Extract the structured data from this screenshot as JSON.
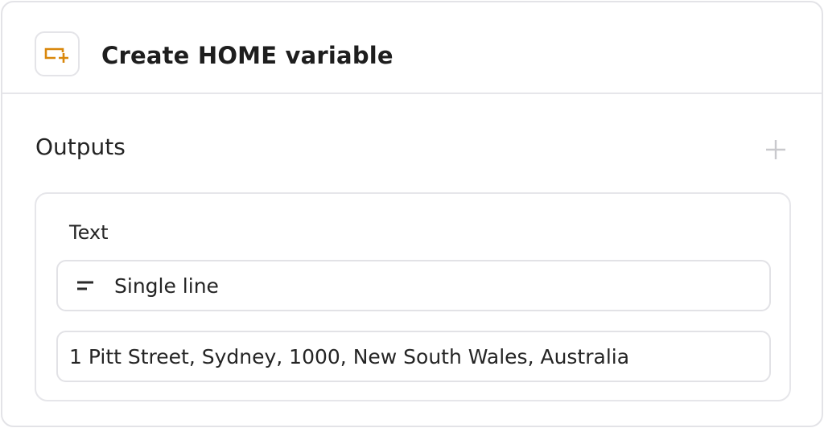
{
  "header": {
    "icon": "variable-add-icon",
    "title": "Create HOME variable",
    "accent_color": "#d9870b"
  },
  "outputs": {
    "title": "Outputs",
    "add_icon": "plus-icon",
    "items": [
      {
        "label": "Text",
        "type_icon": "single-line-icon",
        "type": "Single line",
        "value": "1 Pitt Street, Sydney, 1000, New South Wales, Australia"
      }
    ]
  }
}
